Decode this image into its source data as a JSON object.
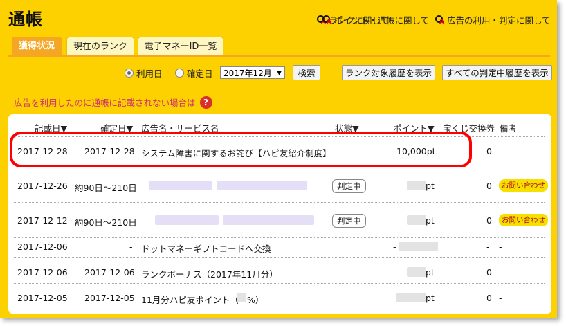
{
  "page_title": "通帳",
  "top_links": [
    {
      "label": "ランクに関して",
      "icon": "rank-search-icon"
    },
    {
      "label": "ポイント・通帳に関して",
      "icon": "rank-search-icon"
    },
    {
      "label": "広告の利用・判定に関して",
      "icon": "rank-search-icon"
    }
  ],
  "tabs": [
    "獲得状況",
    "現在のランク",
    "電子マネーID一覧"
  ],
  "filters": {
    "radio_usage_date": "利用日",
    "radio_confirm_date": "確定日",
    "month_value": "2017年12月",
    "search_button": "検索",
    "rank_history_button": "ランク対象履歴を表示",
    "all_pending_button": "すべての判定中履歴を表示"
  },
  "notice": {
    "text": "広告を利用したのに通帳に記載されない場合は",
    "icon": "?"
  },
  "table": {
    "headers": [
      "記載日▼",
      "確定日▼",
      "広告名・サービス名",
      "状態▼",
      "ポイント▼",
      "宝くじ交換券",
      "備考"
    ],
    "rows": [
      {
        "recorded": "2017-12-28",
        "confirmed": "2017-12-28",
        "name": "システム障害に関するお詫び【ハピ友紹介制度】",
        "status": "",
        "points": "10,000pt",
        "lottery": "0",
        "note": "-"
      },
      {
        "recorded": "2017-12-26",
        "confirmed": "約90日～210日",
        "name": "",
        "status": "判定中",
        "points": "pt",
        "lottery": "0",
        "note": "お問い合わせ"
      },
      {
        "recorded": "2017-12-12",
        "confirmed": "約90日～210日",
        "name": "",
        "status": "判定中",
        "points": "pt",
        "lottery": "0",
        "note": "お問い合わせ"
      },
      {
        "recorded": "2017-12-06",
        "confirmed": "-",
        "name": "ドットマネーギフトコードへ交換",
        "status": "",
        "points": "-",
        "lottery": "-",
        "note": "-"
      },
      {
        "recorded": "2017-12-06",
        "confirmed": "2017-12-06",
        "name": "ランクボーナス（2017年11月分）",
        "status": "",
        "points": "pt",
        "lottery": "0",
        "note": "-"
      },
      {
        "recorded": "2017-12-05",
        "confirmed": "2017-12-05",
        "name": "11月分ハピ友ポイント（",
        "name_suffix": "%）",
        "status": "",
        "points": "pt",
        "lottery": "0",
        "note": "-"
      }
    ]
  },
  "colors": {
    "frame": "#fdd000",
    "active_tab": "#f5a623",
    "highlight": "#ff0000",
    "notice_text": "#d0306e"
  }
}
